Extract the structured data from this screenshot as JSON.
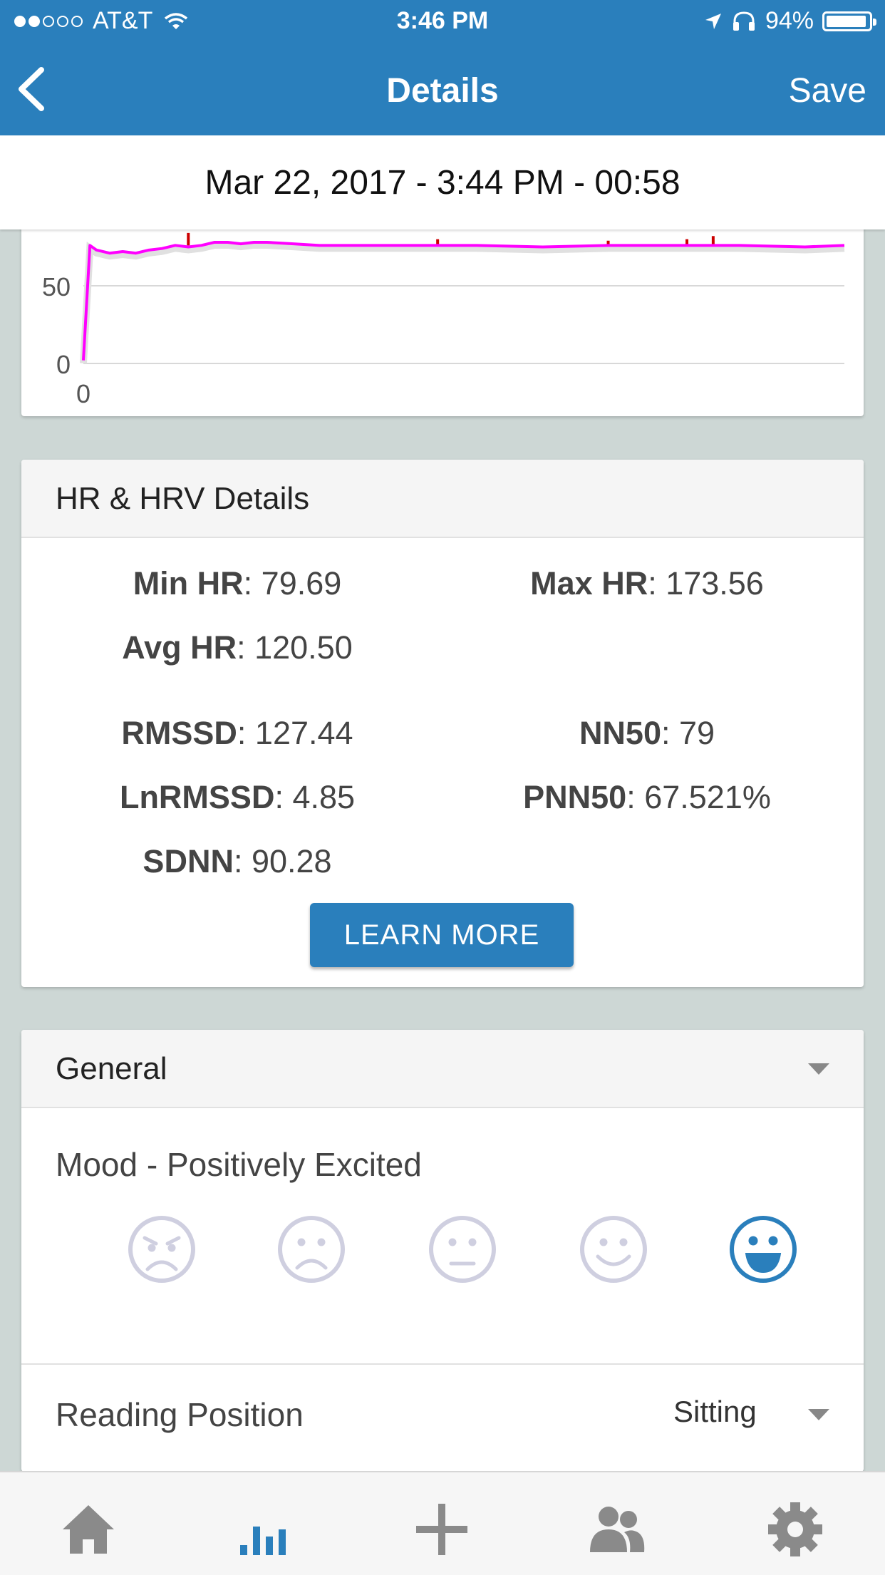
{
  "status": {
    "carrier": "AT&T",
    "time": "3:46 PM",
    "battery": "94%",
    "battery_level": 0.94
  },
  "nav": {
    "title": "Details",
    "save": "Save",
    "back_icon": "chevron-left-icon"
  },
  "session": {
    "datetime": "Mar 22, 2017 - 3:44 PM - 00:58"
  },
  "chart_data": {
    "type": "line",
    "title": "",
    "xlabel": "",
    "ylabel": "",
    "y_tick_labels": [
      "0",
      "50"
    ],
    "x_tick_labels": [
      "0"
    ],
    "series_color": "#ff00ff",
    "spike_color": "#cc0000",
    "x": [
      0,
      0.5,
      1,
      2,
      3,
      4,
      5,
      6,
      7,
      8,
      9,
      10,
      11,
      12,
      13,
      14,
      16,
      18,
      20,
      25,
      30,
      35,
      40,
      45,
      50,
      55,
      58
    ],
    "y": [
      2,
      76,
      73,
      71,
      72,
      71,
      73,
      74,
      76,
      75,
      76,
      78,
      78,
      77,
      78,
      78,
      77,
      76,
      76,
      76,
      76,
      75,
      76,
      76,
      76,
      75,
      76
    ]
  },
  "hrv": {
    "title": "HR & HRV Details",
    "min_hr_label": "Min HR",
    "min_hr_value": ": 79.69",
    "max_hr_label": "Max HR",
    "max_hr_value": ": 173.56",
    "avg_hr_label": "Avg HR",
    "avg_hr_value": ": 120.50",
    "rmssd_label": "RMSSD",
    "rmssd_value": ": 127.44",
    "nn50_label": "NN50",
    "nn50_value": ": 79",
    "lnrmssd_label": "LnRMSSD",
    "lnrmssd_value": ": 4.85",
    "pnn50_label": "PNN50",
    "pnn50_value": ": 67.521%",
    "sdnn_label": "SDNN",
    "sdnn_value": ": 90.28",
    "learn_more": "LEARN MORE"
  },
  "general": {
    "title": "General",
    "mood_label": "Mood - Positively Excited",
    "moods": [
      "angry-face-icon",
      "sad-face-icon",
      "neutral-face-icon",
      "smile-face-icon",
      "excited-face-icon"
    ],
    "selected_mood": 4,
    "reading_position_label": "Reading Position",
    "reading_position_value": "Sitting"
  },
  "colors": {
    "accent": "#2a7fbc",
    "mood_inactive": "#cfcfe0",
    "background": "#cdd7d5"
  },
  "tabbar": [
    "home-icon",
    "stats-icon",
    "add-icon",
    "people-icon",
    "settings-icon"
  ],
  "tab_selected": 1
}
